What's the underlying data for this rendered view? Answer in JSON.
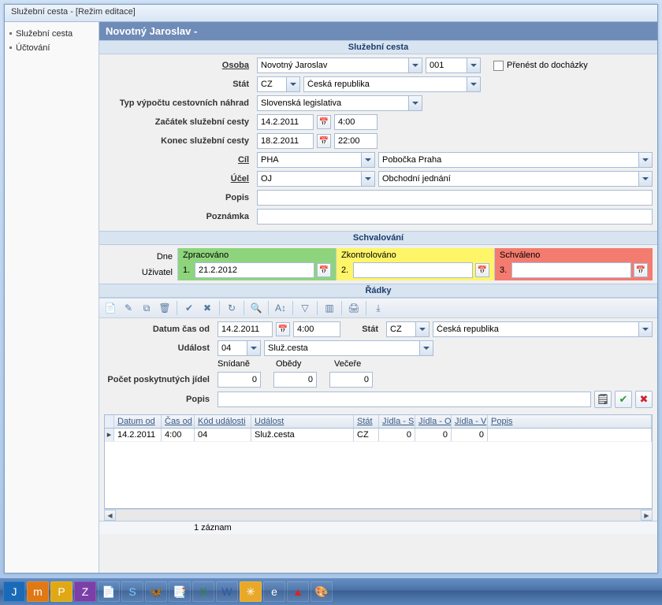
{
  "window_title": "Služební cesta - [Režim editace]",
  "sidebar": {
    "items": [
      {
        "label": "Služební cesta"
      },
      {
        "label": "Účtování"
      }
    ]
  },
  "header": {
    "title": "Novotný Jaroslav  -"
  },
  "section1": {
    "title": "Služební cesta",
    "labels": {
      "osoba": "Osoba",
      "stat": "Stát",
      "typvypoctu": "Typ výpočtu cestovních náhrad",
      "zacatek": "Začátek služební cesty",
      "konec": "Konec služební cesty",
      "cil": "Cíl",
      "ucel": "Účel",
      "popis": "Popis",
      "poznamka": "Poznámka"
    },
    "osoba_name": "Novotný Jaroslav",
    "osoba_code": "001",
    "prenest_label": "Přenést do docházky",
    "stat_code": "CZ",
    "stat_name": "Česká republika",
    "typvypoctu": "Slovenská legislativa",
    "zacatek_date": "14.2.2011",
    "zacatek_time": "4:00",
    "konec_date": "18.2.2011",
    "konec_time": "22:00",
    "cil_code": "PHA",
    "cil_name": "Pobočka Praha",
    "ucel_code": "OJ",
    "ucel_name": "Obchodní jednání",
    "popis": "",
    "poznamka": ""
  },
  "section2": {
    "title": "Schvalování",
    "dne_label": "Dne",
    "uzivatel_label": "Uživatel",
    "cols": [
      {
        "head": "Zpracováno",
        "num": "1.",
        "date": "21.2.2012"
      },
      {
        "head": "Zkontrolováno",
        "num": "2.",
        "date": ""
      },
      {
        "head": "Schváleno",
        "num": "3.",
        "date": ""
      }
    ]
  },
  "section3": {
    "title": "Řádky",
    "labels": {
      "datumcasod": "Datum čas od",
      "stat": "Stát",
      "udalost": "Událost",
      "pocetjidel": "Počet poskytnutých jídel",
      "snidane": "Snídaně",
      "obedy": "Obědy",
      "vecere": "Večeře",
      "popis": "Popis"
    },
    "datum": "14.2.2011",
    "cas": "4:00",
    "stat_code": "CZ",
    "stat_name": "Česká republika",
    "udalost_code": "04",
    "udalost_name": "Služ.cesta",
    "snidane": "0",
    "obedy": "0",
    "vecere": "0",
    "popis": "",
    "grid": {
      "cols": [
        "Datum od",
        "Čas od",
        "Kód události",
        "Událost",
        "Stát",
        "Jídla - S",
        "Jídla - O",
        "Jídla - V",
        "Popis"
      ],
      "rows": [
        {
          "datum": "14.2.2011",
          "cas": "4:00",
          "kod": "04",
          "udalost": "Služ.cesta",
          "stat": "CZ",
          "js": "0",
          "jo": "0",
          "jv": "0",
          "popis": ""
        }
      ]
    },
    "status": "1 záznam"
  }
}
